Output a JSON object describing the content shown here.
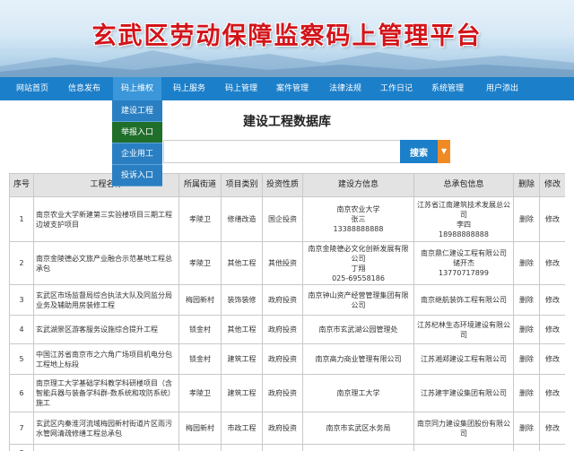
{
  "header": {
    "title": "玄武区劳动保障监察码上管理平台"
  },
  "nav": {
    "items": [
      {
        "label": "网站首页"
      },
      {
        "label": "信息发布"
      },
      {
        "label": "码上维权"
      },
      {
        "label": "码上服务"
      },
      {
        "label": "码上管理"
      },
      {
        "label": "案件管理"
      },
      {
        "label": "法律法规"
      },
      {
        "label": "工作日记"
      },
      {
        "label": "系统管理"
      },
      {
        "label": "用户添出"
      }
    ],
    "active_index": 2
  },
  "dropdown": {
    "items": [
      {
        "label": "建设工程"
      },
      {
        "label": "举报入口"
      },
      {
        "label": "企业用工"
      },
      {
        "label": "投诉入口"
      }
    ],
    "active_index": 1
  },
  "page": {
    "title": "建设工程数据库"
  },
  "search": {
    "value": "",
    "placeholder": "",
    "button_label": "搜索"
  },
  "table": {
    "headers": [
      "序号",
      "工程名称",
      "所属街道",
      "项目类别",
      "投资性质",
      "建设方信息",
      "总承包信息",
      "删除",
      "修改"
    ],
    "rows": [
      {
        "no": "1",
        "name": "南京农业大学新建第三实验楼项目三期工程边坡支护项目",
        "street": "孝陵卫",
        "category": "修缮改造",
        "invest": "国企投资",
        "owner": "南京农业大学\n张三\n13388888888",
        "contractor": "江苏省江南建筑技术发展总公司\n李四\n18988888888",
        "del": "删除",
        "edit": "修改"
      },
      {
        "no": "2",
        "name": "南京金陵德必文旅产业融合示范基地工程总承包",
        "street": "孝陵卫",
        "category": "其他工程",
        "invest": "其他投资",
        "owner": "南京金陵德必文化创新发展有限公司\n丁翔\n025-69558186",
        "contractor": "南京鼎仁建设工程有限公司\n储开杰\n13770717899",
        "del": "删除",
        "edit": "修改"
      },
      {
        "no": "3",
        "name": "玄武区市场监督局综合执法大队及同监分局业务及辅助用房装修工程",
        "street": "梅园新村",
        "category": "装饰装修",
        "invest": "政府投资",
        "owner": "南京钟山资产经营管理集团有限公司",
        "contractor": "南京继航装饰工程有限公司",
        "del": "删除",
        "edit": "修改"
      },
      {
        "no": "4",
        "name": "玄武湖景区游客服务设施综合提升工程",
        "street": "锁金村",
        "category": "其他工程",
        "invest": "政府投资",
        "owner": "南京市玄武湖公园管理处",
        "contractor": "江苏杞林生态环境建设有限公司",
        "del": "删除",
        "edit": "修改"
      },
      {
        "no": "5",
        "name": "中国江苏省南京市之六角广场项目机电分包工程地上标段",
        "street": "锁金村",
        "category": "建筑工程",
        "invest": "政府投资",
        "owner": "南京高力商业管理有限公司",
        "contractor": "江苏湘郑建设工程有限公司",
        "del": "删除",
        "edit": "修改"
      },
      {
        "no": "6",
        "name": "南京理工大学基础学科教学科研楼项目（含智能兵器与装备学科群-数系统和攻防系统）施工",
        "street": "孝陵卫",
        "category": "建筑工程",
        "invest": "政府投资",
        "owner": "南京理工大学",
        "contractor": "江苏建宇建设集团有限公司",
        "del": "删除",
        "edit": "修改"
      },
      {
        "no": "7",
        "name": "玄武区内秦淮河流域梅园新村街道片区雨污水管网清疏修缮工程总承包",
        "street": "梅园新村",
        "category": "市政工程",
        "invest": "政府投资",
        "owner": "南京市玄武区水务局",
        "contractor": "南京同力建设集团股份有限公司",
        "del": "删除",
        "edit": "修改"
      },
      {
        "no": "8",
        "name": "",
        "street": "",
        "category": "",
        "invest": "",
        "owner": "",
        "contractor": "",
        "del": "",
        "edit": ""
      }
    ]
  },
  "colors": {
    "title_red": "#d2141a",
    "nav_blue": "#1c7fc9",
    "search_orange": "#f08a24",
    "dropdown_active": "#1f6e2a"
  }
}
